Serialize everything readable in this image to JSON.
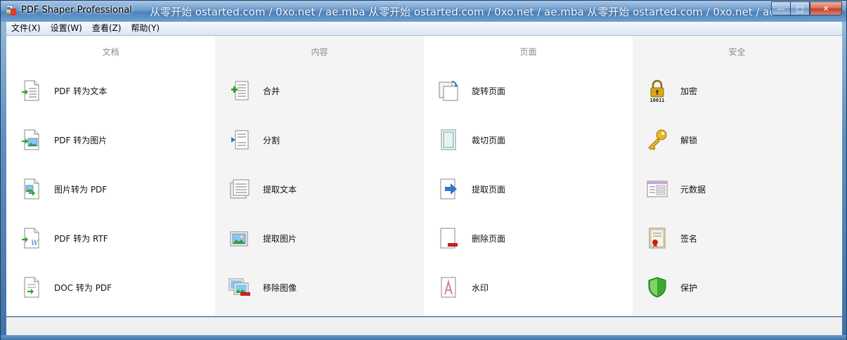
{
  "window": {
    "title": "PDF Shaper Professional",
    "watermark": "从零开始 ostarted.com / 0xo.net / ae.mba 从零开始 ostarted.com / 0xo.net / ae.mba 从零开始 ostarted.com / 0xo.net / ae.mba",
    "minimize_label": "—",
    "maximize_label": "□",
    "close_label": "✕"
  },
  "menu": [
    "文件(X)",
    "设置(W)",
    "查看(Z)",
    "帮助(Y)"
  ],
  "columns": [
    {
      "header": "文档",
      "items": [
        {
          "label": "PDF 转为文本",
          "icon": "pdf-to-text-icon"
        },
        {
          "label": "PDF 转为图片",
          "icon": "pdf-to-image-icon"
        },
        {
          "label": "图片转为 PDF",
          "icon": "image-to-pdf-icon"
        },
        {
          "label": "PDF 转为 RTF",
          "icon": "pdf-to-rtf-icon"
        },
        {
          "label": "DOC 转为 PDF",
          "icon": "doc-to-pdf-icon"
        }
      ]
    },
    {
      "header": "内容",
      "items": [
        {
          "label": "合并",
          "icon": "merge-icon"
        },
        {
          "label": "分割",
          "icon": "split-icon"
        },
        {
          "label": "提取文本",
          "icon": "extract-text-icon"
        },
        {
          "label": "提取图片",
          "icon": "extract-images-icon"
        },
        {
          "label": "移除图像",
          "icon": "remove-images-icon"
        }
      ]
    },
    {
      "header": "页面",
      "items": [
        {
          "label": "旋转页面",
          "icon": "rotate-pages-icon"
        },
        {
          "label": "裁切页面",
          "icon": "crop-pages-icon"
        },
        {
          "label": "提取页面",
          "icon": "extract-pages-icon"
        },
        {
          "label": "删除页面",
          "icon": "delete-pages-icon"
        },
        {
          "label": "水印",
          "icon": "watermark-icon"
        }
      ]
    },
    {
      "header": "安全",
      "items": [
        {
          "label": "加密",
          "icon": "encrypt-lock-icon"
        },
        {
          "label": "解锁",
          "icon": "unlock-key-icon"
        },
        {
          "label": "元数据",
          "icon": "metadata-icon"
        },
        {
          "label": "签名",
          "icon": "signature-certificate-icon"
        },
        {
          "label": "保护",
          "icon": "protect-shield-icon"
        }
      ]
    }
  ],
  "lock_icon_text": "10011",
  "colors": {
    "accent_green": "#2e9e2e",
    "accent_blue": "#2f77d0",
    "accent_red": "#c62020",
    "lock_gold": "#d8a81a",
    "shield_green": "#3aaa2a"
  }
}
